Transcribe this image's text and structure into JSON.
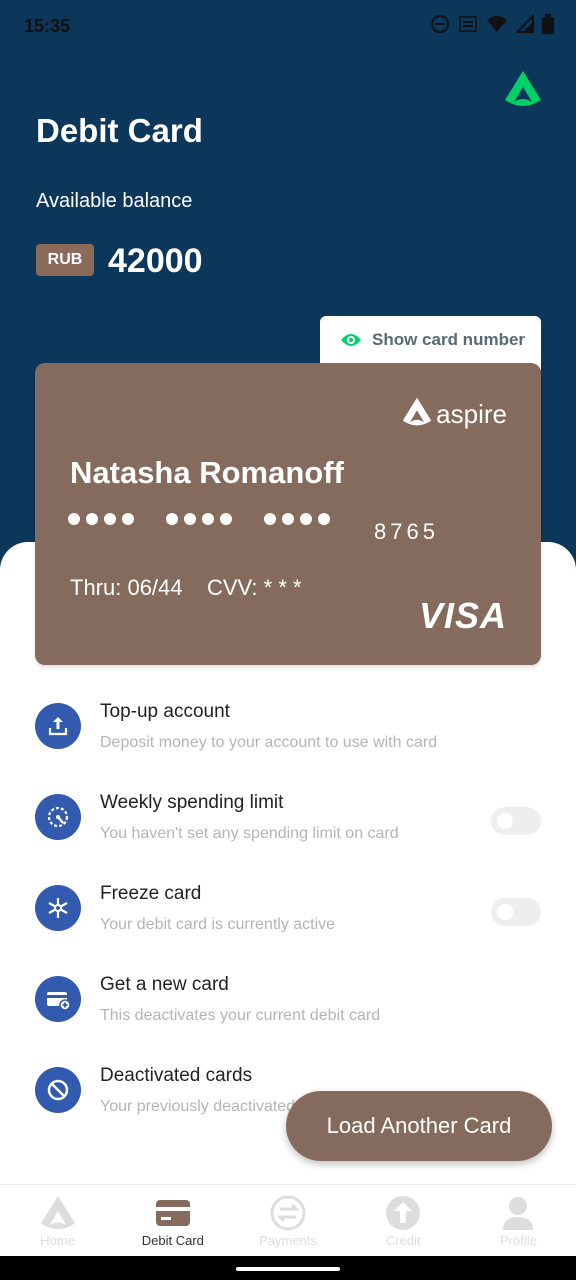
{
  "status_bar": {
    "time": "15:35"
  },
  "header": {
    "title": "Debit Card",
    "balance_label": "Available balance",
    "currency": "RUB",
    "balance": "42000"
  },
  "show_card_number": {
    "label": "Show card number"
  },
  "card": {
    "brand": "aspire",
    "holder": "Natasha Romanoff",
    "last4": "8765",
    "expiry": "Thru: 06/44",
    "cvv": "CVV: * * *",
    "network": "VISA",
    "color": "#856b5d"
  },
  "menu": {
    "items": [
      {
        "title": "Top-up account",
        "subtitle": "Deposit money to your account to use with card",
        "icon": "upload-icon",
        "toggle": null
      },
      {
        "title": "Weekly spending limit",
        "subtitle": "You haven't set any spending limit on card",
        "icon": "gauge-icon",
        "toggle": false
      },
      {
        "title": "Freeze card",
        "subtitle": "Your debit card is currently active",
        "icon": "snowflake-icon",
        "toggle": false
      },
      {
        "title": "Get a new card",
        "subtitle": "This deactivates your current debit card",
        "icon": "new-card-icon",
        "toggle": null
      },
      {
        "title": "Deactivated cards",
        "subtitle": "Your previously deactivated cards",
        "icon": "block-icon",
        "toggle": null
      }
    ]
  },
  "fab": {
    "label": "Load Another Card"
  },
  "bottom_nav": {
    "items": [
      {
        "label": "Home",
        "icon": "home-logo-icon",
        "active": false
      },
      {
        "label": "Debit Card",
        "icon": "card-icon",
        "active": true
      },
      {
        "label": "Payments",
        "icon": "payments-icon",
        "active": false
      },
      {
        "label": "Credit",
        "icon": "credit-icon",
        "active": false
      },
      {
        "label": "Profile",
        "icon": "profile-icon",
        "active": false
      }
    ]
  },
  "colors": {
    "primary_bg": "#0c365a",
    "accent_green": "#01d167",
    "card_brown": "#856b5d",
    "icon_blue": "#325baf"
  }
}
